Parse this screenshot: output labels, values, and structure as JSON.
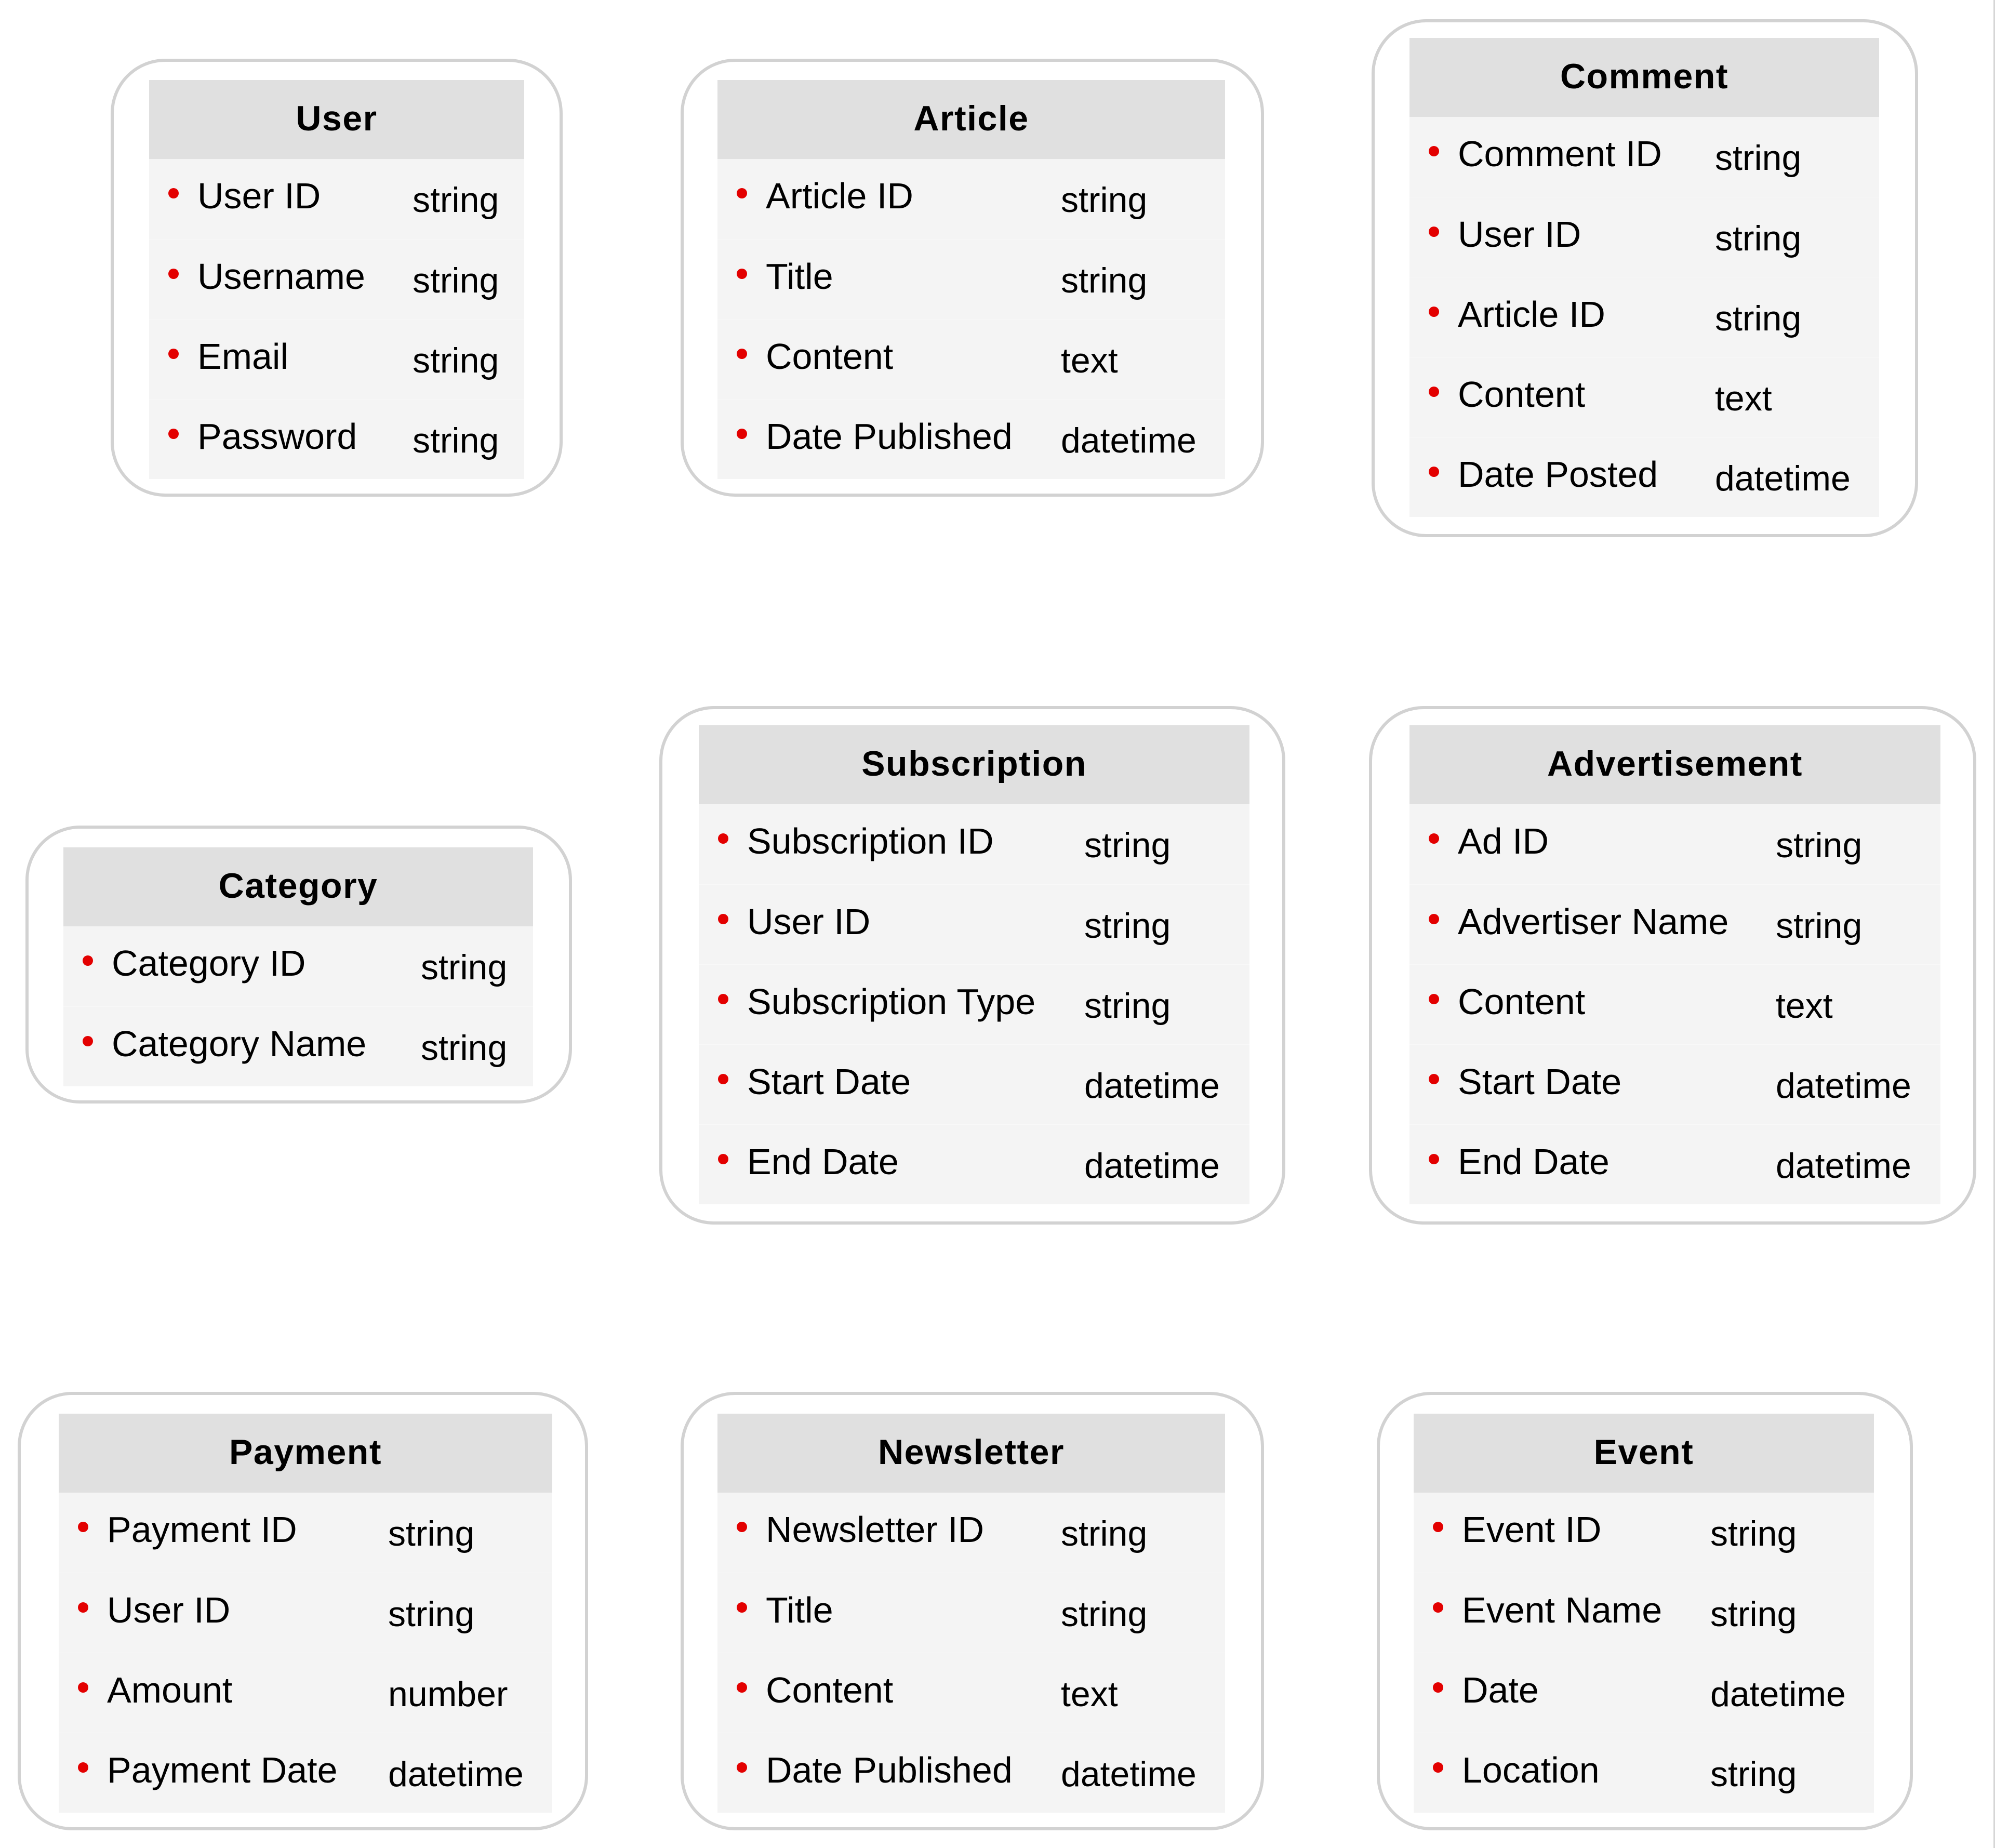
{
  "diagram": {
    "type": "entity-relationship",
    "colors": {
      "bullet": "#e30000",
      "header_background": "#e0e0e0",
      "row_background": "#f4f4f4",
      "entity_border": "#d2d2d2"
    },
    "entities": [
      {
        "key": "user",
        "name": "User",
        "attributes": [
          {
            "name": "User ID",
            "type": "string"
          },
          {
            "name": "Username",
            "type": "string"
          },
          {
            "name": "Email",
            "type": "string"
          },
          {
            "name": "Password",
            "type": "string"
          }
        ]
      },
      {
        "key": "article",
        "name": "Article",
        "attributes": [
          {
            "name": "Article ID",
            "type": "string"
          },
          {
            "name": "Title",
            "type": "string"
          },
          {
            "name": "Content",
            "type": "text"
          },
          {
            "name": "Date Published",
            "type": "datetime"
          }
        ]
      },
      {
        "key": "comment",
        "name": "Comment",
        "attributes": [
          {
            "name": "Comment ID",
            "type": "string"
          },
          {
            "name": "User ID",
            "type": "string"
          },
          {
            "name": "Article ID",
            "type": "string"
          },
          {
            "name": "Content",
            "type": "text"
          },
          {
            "name": "Date Posted",
            "type": "datetime"
          }
        ]
      },
      {
        "key": "category",
        "name": "Category",
        "attributes": [
          {
            "name": "Category ID",
            "type": "string"
          },
          {
            "name": "Category Name",
            "type": "string"
          }
        ]
      },
      {
        "key": "subscription",
        "name": "Subscription",
        "attributes": [
          {
            "name": "Subscription ID",
            "type": "string"
          },
          {
            "name": "User ID",
            "type": "string"
          },
          {
            "name": "Subscription Type",
            "type": "string"
          },
          {
            "name": "Start Date",
            "type": "datetime"
          },
          {
            "name": "End Date",
            "type": "datetime"
          }
        ]
      },
      {
        "key": "advertisement",
        "name": "Advertisement",
        "attributes": [
          {
            "name": "Ad ID",
            "type": "string"
          },
          {
            "name": "Advertiser Name",
            "type": "string"
          },
          {
            "name": "Content",
            "type": "text"
          },
          {
            "name": "Start Date",
            "type": "datetime"
          },
          {
            "name": "End Date",
            "type": "datetime"
          }
        ]
      },
      {
        "key": "payment",
        "name": "Payment",
        "attributes": [
          {
            "name": "Payment ID",
            "type": "string"
          },
          {
            "name": "User ID",
            "type": "string"
          },
          {
            "name": "Amount",
            "type": "number"
          },
          {
            "name": "Payment Date",
            "type": "datetime"
          }
        ]
      },
      {
        "key": "newsletter",
        "name": "Newsletter",
        "attributes": [
          {
            "name": "Newsletter ID",
            "type": "string"
          },
          {
            "name": "Title",
            "type": "string"
          },
          {
            "name": "Content",
            "type": "text"
          },
          {
            "name": "Date Published",
            "type": "datetime"
          }
        ]
      },
      {
        "key": "event",
        "name": "Event",
        "attributes": [
          {
            "name": "Event ID",
            "type": "string"
          },
          {
            "name": "Event Name",
            "type": "string"
          },
          {
            "name": "Date",
            "type": "datetime"
          },
          {
            "name": "Location",
            "type": "string"
          }
        ]
      }
    ]
  }
}
